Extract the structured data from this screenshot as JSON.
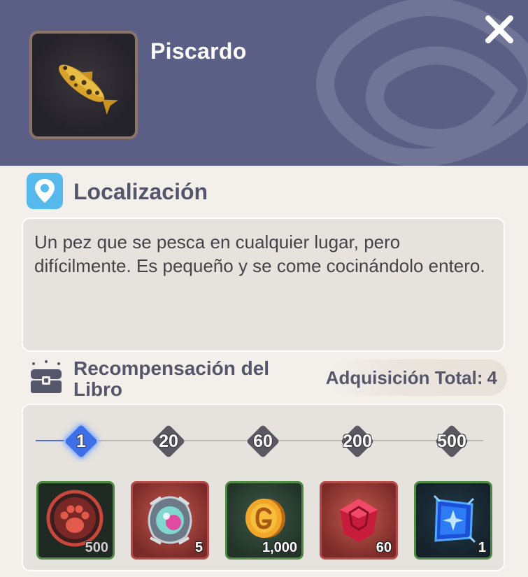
{
  "item": {
    "name": "Piscardo",
    "icon": "golden-fish-icon"
  },
  "location": {
    "title": "Localización",
    "icon": "map-pin-icon",
    "description": "Un pez que se pesca en cualquier lugar, pero difícilmente. Es pequeño y se come cocinándolo entero."
  },
  "book_reward": {
    "title": "Recompensación del Libro",
    "icon": "treasure-chest-icon",
    "acquisition_label": "Adquisición Total:",
    "acquisition_count": "4",
    "milestones": [
      {
        "label": "1",
        "active": true
      },
      {
        "label": "20",
        "active": false
      },
      {
        "label": "60",
        "active": false
      },
      {
        "label": "200",
        "active": false
      },
      {
        "label": "500",
        "active": false
      }
    ],
    "rewards": [
      {
        "icon": "paw-token-icon",
        "quantity": "500"
      },
      {
        "icon": "crystal-orb-icon",
        "quantity": "5"
      },
      {
        "icon": "gold-coin-icon",
        "quantity": "1,000"
      },
      {
        "icon": "red-gem-icon",
        "quantity": "60"
      },
      {
        "icon": "blue-crystal-icon",
        "quantity": "1"
      }
    ]
  },
  "colors": {
    "header_bg": "#5b5f86",
    "panel_bg": "#f3f0ec",
    "box_bg": "#e6e3de",
    "accent_blue": "#3f6fe6",
    "location_icon_bg": "#56b9ec"
  }
}
